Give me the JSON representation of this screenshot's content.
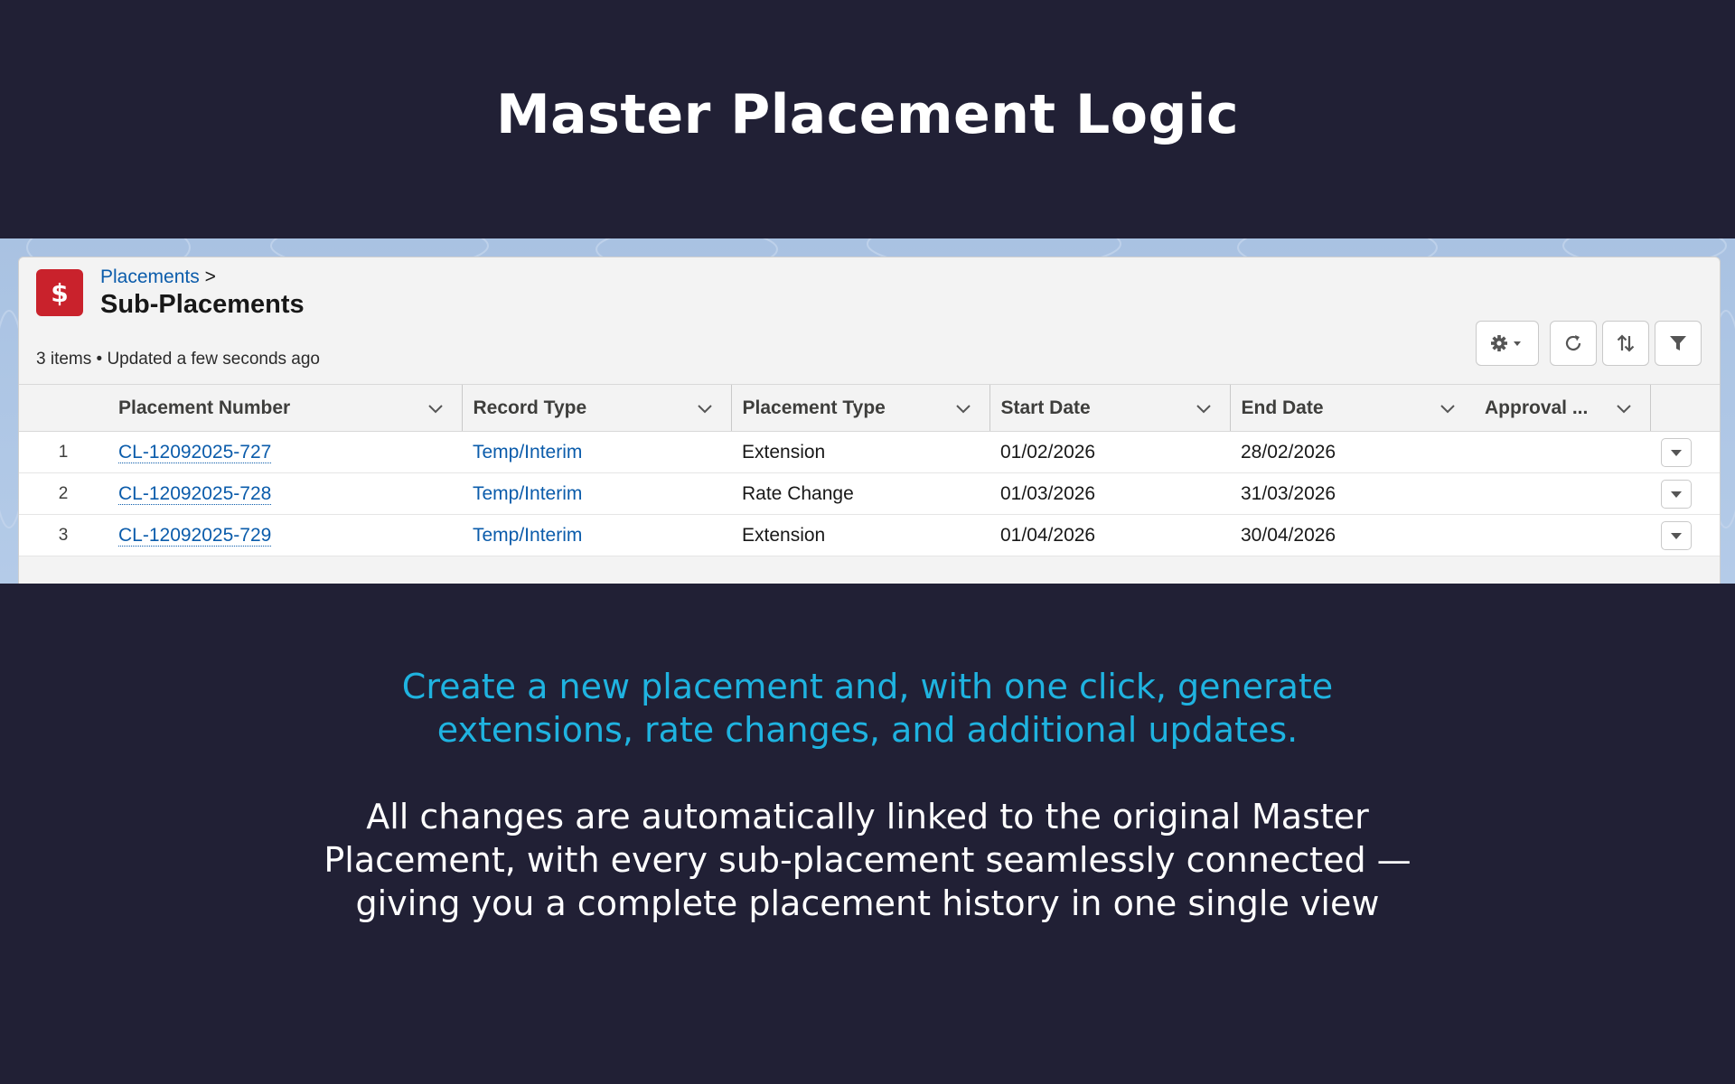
{
  "headline": "Master Placement Logic",
  "list_view": {
    "breadcrumb_parent": "Placements",
    "breadcrumb_separator": ">",
    "title": "Sub-Placements",
    "object_icon": "dollar-icon",
    "object_icon_glyph": "$",
    "object_icon_color": "#c9222c",
    "meta": "3 items • Updated a few seconds ago",
    "toolbar": [
      "settings-icon",
      "refresh-icon",
      "sort-icon",
      "filter-icon"
    ],
    "columns": [
      "Placement Number",
      "Record Type",
      "Placement Type",
      "Start Date",
      "End Date",
      "Approval ..."
    ],
    "rows": [
      {
        "num": "1",
        "placement_number": "CL-12092025-727",
        "record_type": "Temp/Interim",
        "placement_type": "Extension",
        "start_date": "01/02/2026",
        "end_date": "28/02/2026",
        "approval": ""
      },
      {
        "num": "2",
        "placement_number": "CL-12092025-728",
        "record_type": "Temp/Interim",
        "placement_type": "Rate Change",
        "start_date": "01/03/2026",
        "end_date": "31/03/2026",
        "approval": ""
      },
      {
        "num": "3",
        "placement_number": "CL-12092025-729",
        "record_type": "Temp/Interim",
        "placement_type": "Extension",
        "start_date": "01/04/2026",
        "end_date": "30/04/2026",
        "approval": ""
      }
    ]
  },
  "highlight_lines": [
    "Create a new placement and, with one click, generate",
    "extensions, rate changes, and additional updates."
  ],
  "body_lines": [
    "All changes are automatically linked to the original Master",
    "Placement, with every sub-placement seamlessly connected —",
    "giving you a complete placement history in one single view"
  ],
  "colors": {
    "background": "#212035",
    "highlight": "#1fb3e0",
    "link": "#0b5cab"
  }
}
